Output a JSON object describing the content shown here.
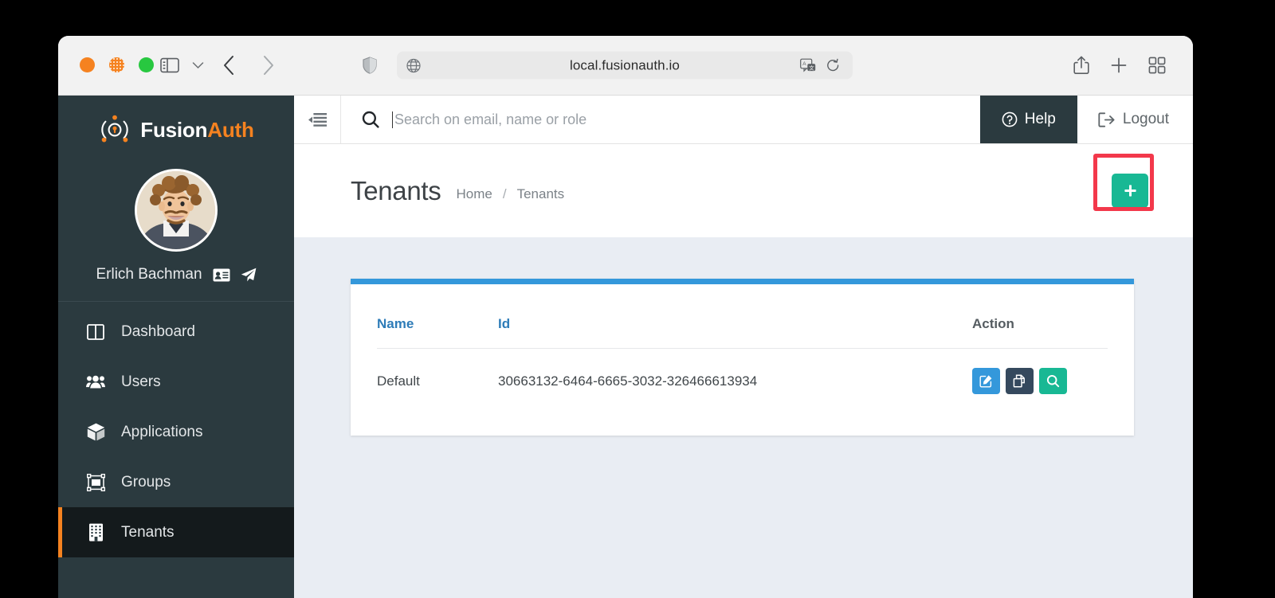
{
  "browser": {
    "url": "local.fusionauth.io",
    "traffic_lights": [
      "close-button",
      "minimize-button",
      "zoom-button"
    ],
    "toolbar_icons": {
      "sidebar": "sidebar-toggle-icon",
      "sidebar_chevron": "chevron-down-icon",
      "back": "chevron-left-icon",
      "forward": "chevron-right-icon",
      "shield": "privacy-shield-icon",
      "globe": "globe-icon",
      "translate": "translate-icon",
      "reload": "reload-icon",
      "share": "share-icon",
      "new_tab": "plus-icon",
      "tab_overview": "tab-overview-icon"
    }
  },
  "sidebar": {
    "brand": {
      "fusion": "Fusion",
      "auth": "Auth",
      "logo_icon": "fusionauth-lock-logo-icon"
    },
    "user": {
      "name": "Erlich Bachman",
      "avatar_icon": "user-avatar-photo",
      "badge_icon": "id-card-icon",
      "impersonate_icon": "paper-plane-icon"
    },
    "items": [
      {
        "label": "Dashboard",
        "icon": "columns-icon",
        "active": false
      },
      {
        "label": "Users",
        "icon": "users-icon",
        "active": false
      },
      {
        "label": "Applications",
        "icon": "cube-icon",
        "active": false
      },
      {
        "label": "Groups",
        "icon": "object-group-icon",
        "active": false
      },
      {
        "label": "Tenants",
        "icon": "building-icon",
        "active": true
      }
    ]
  },
  "topbar": {
    "collapse_icon": "collapse-sidebar-icon",
    "search": {
      "icon": "search-icon",
      "value": "",
      "placeholder": "Search on email, name or role"
    },
    "help_label": "Help",
    "help_icon": "question-circle-icon",
    "logout_label": "Logout",
    "logout_icon": "sign-out-icon"
  },
  "page": {
    "title": "Tenants",
    "breadcrumb": {
      "home": "Home",
      "separator": "/",
      "current": "Tenants"
    },
    "add_button": {
      "label": "+",
      "icon": "plus-icon",
      "color": "#18b894",
      "highlight_color": "#f3384b"
    }
  },
  "table": {
    "accent_color": "#3498db",
    "headers": {
      "name": "Name",
      "id": "Id",
      "action": "Action"
    },
    "rows": [
      {
        "name": "Default",
        "id": "30663132-6464-6665-3032-326466613934",
        "actions": [
          {
            "name": "edit-tenant-button",
            "icon": "pencil-square-icon",
            "color": "#3498db"
          },
          {
            "name": "duplicate-tenant-button",
            "icon": "copy-files-icon",
            "color": "#35495e"
          },
          {
            "name": "view-tenant-button",
            "icon": "magnifier-icon",
            "color": "#18b894"
          }
        ]
      }
    ]
  }
}
